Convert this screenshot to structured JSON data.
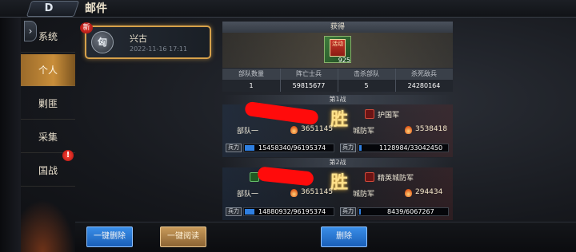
{
  "header": {
    "title": "邮件",
    "back_glyph": "D"
  },
  "tabs": [
    {
      "label": "系统"
    },
    {
      "label": "个人",
      "active": true
    },
    {
      "label": "剿匪"
    },
    {
      "label": "采集"
    },
    {
      "label": "国战",
      "badge": "!"
    }
  ],
  "mail_list": [
    {
      "new_badge": "新",
      "avatar_text": "匈",
      "sender": "兴古",
      "time": "2022-11-16   17:11"
    }
  ],
  "detail": {
    "gain_label": "获得",
    "item": {
      "label": "活动",
      "count": "925"
    },
    "stats_headers": [
      "部队数量",
      "阵亡士兵",
      "击杀部队",
      "杀死敌兵"
    ],
    "stats_values": [
      "1",
      "59815677",
      "5",
      "24280164"
    ],
    "battles": [
      {
        "title": "第1战",
        "result": "胜",
        "left_name": "部队一",
        "left_power": "3651145",
        "enemy_name": "护国军",
        "enemy_label": "城防军",
        "right_power": "3538418",
        "soldier_label": "兵力",
        "left_troops": "15458340/96195374",
        "left_ratio": 0.16,
        "right_troops": "1128984/33042450",
        "right_ratio": 0.03
      },
      {
        "title": "第2战",
        "result": "胜",
        "left_name": "部队一",
        "left_power": "3651145",
        "enemy_name": "精英城防军",
        "enemy_label": "城防军",
        "right_power": "294434",
        "soldier_label": "兵力",
        "left_troops": "14880932/96195374",
        "left_ratio": 0.15,
        "right_troops": "8439/6067267",
        "right_ratio": 0.001
      }
    ]
  },
  "buttons": {
    "delete_all": "一键删除",
    "read_all": "一键阅读",
    "delete": "删除"
  }
}
